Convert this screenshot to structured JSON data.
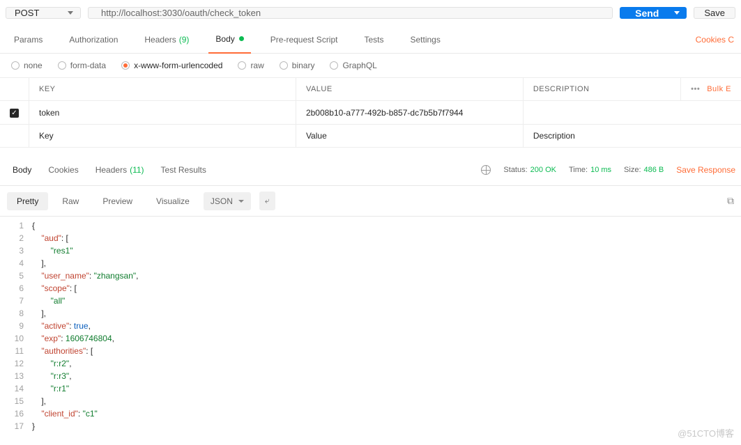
{
  "request": {
    "method": "POST",
    "url": "http://localhost:3030/oauth/check_token",
    "actions": {
      "send": "Send",
      "save": "Save"
    }
  },
  "reqTabs": {
    "params": "Params",
    "auth": "Authorization",
    "headers": "Headers",
    "headersCount": "(9)",
    "body": "Body",
    "prereq": "Pre-request Script",
    "tests": "Tests",
    "settings": "Settings",
    "cookies": "Cookies  C"
  },
  "bodyTypes": {
    "none": "none",
    "form": "form-data",
    "xwww": "x-www-form-urlencoded",
    "raw": "raw",
    "binary": "binary",
    "graphql": "GraphQL"
  },
  "paramsTable": {
    "headers": {
      "key": "KEY",
      "value": "VALUE",
      "desc": "DESCRIPTION",
      "bulk": "Bulk E"
    },
    "rows": [
      {
        "key": "token",
        "value": "2b008b10-a777-492b-b857-dc7b5b7f7944",
        "desc": ""
      }
    ],
    "placeholders": {
      "key": "Key",
      "value": "Value",
      "desc": "Description"
    }
  },
  "resTabs": {
    "body": "Body",
    "cookies": "Cookies",
    "headers": "Headers",
    "headersCount": "(11)",
    "tests": "Test Results"
  },
  "resMeta": {
    "statusLabel": "Status:",
    "statusValue": "200 OK",
    "timeLabel": "Time:",
    "timeValue": "10 ms",
    "sizeLabel": "Size:",
    "sizeValue": "486 B",
    "save": "Save Response"
  },
  "viewBar": {
    "pretty": "Pretty",
    "raw": "Raw",
    "preview": "Preview",
    "visualize": "Visualize",
    "format": "JSON"
  },
  "responseBody": {
    "aud": [
      "res1"
    ],
    "user_name": "zhangsan",
    "scope": [
      "all"
    ],
    "active": true,
    "exp": 1606746804,
    "authorities": [
      "r:r2",
      "r:r3",
      "r:r1"
    ],
    "client_id": "c1"
  },
  "chart_data": {
    "type": "table",
    "title": "Response JSON",
    "data": {
      "aud": [
        "res1"
      ],
      "user_name": "zhangsan",
      "scope": [
        "all"
      ],
      "active": true,
      "exp": 1606746804,
      "authorities": [
        "r:r2",
        "r:r3",
        "r:r1"
      ],
      "client_id": "c1"
    }
  },
  "watermark": "@51CTO博客"
}
